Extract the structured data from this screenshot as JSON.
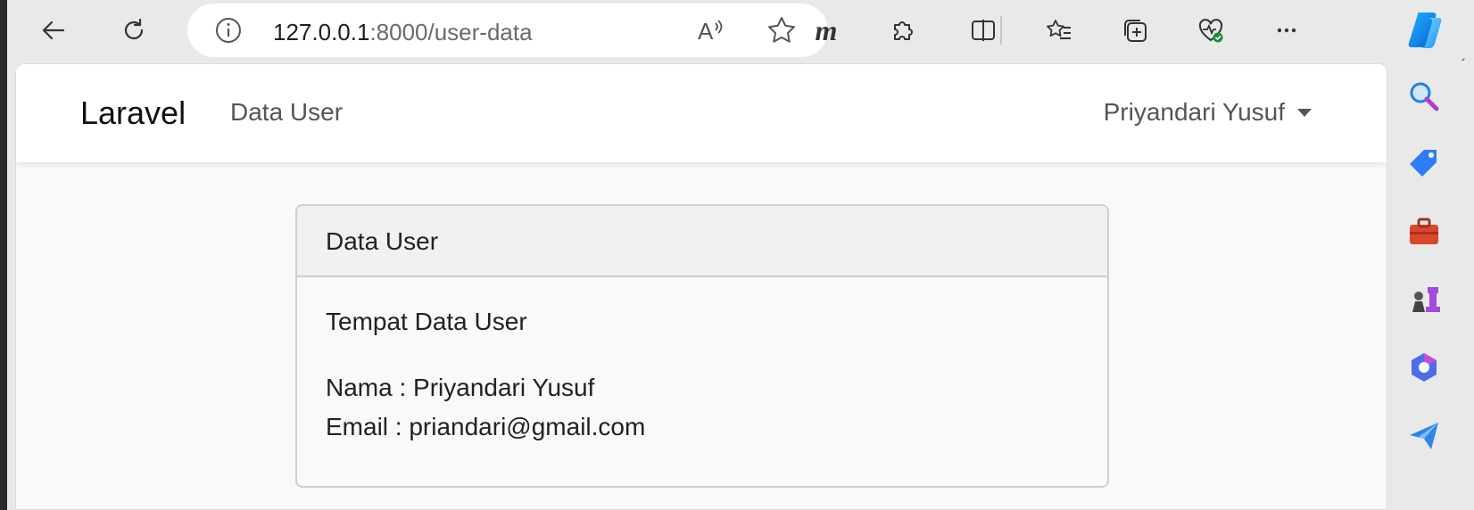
{
  "browser": {
    "url_host": "127.0.0.1",
    "url_rest": ":8000/user-data",
    "toolbar_icons": [
      "back-icon",
      "refresh-icon",
      "info-icon",
      "read-aloud-icon",
      "favorite-star-icon",
      "m-extension-icon",
      "extensions-puzzle-icon",
      "split-screen-icon",
      "favorites-list-icon",
      "collections-icon",
      "browser-essentials-icon",
      "more-icon",
      "copilot-icon"
    ],
    "sidebar_icons": [
      "search-icon",
      "shopping-tag-icon",
      "tools-icon",
      "games-icon",
      "microsoft365-icon",
      "outlook-send-icon"
    ]
  },
  "navbar": {
    "brand": "Laravel",
    "link": "Data User",
    "user": "Priyandari Yusuf"
  },
  "card": {
    "header": "Data User",
    "subtitle": "Tempat Data User",
    "name_line": "Nama : Priyandari Yusuf",
    "email_line": "Email : priandari@gmail.com"
  }
}
